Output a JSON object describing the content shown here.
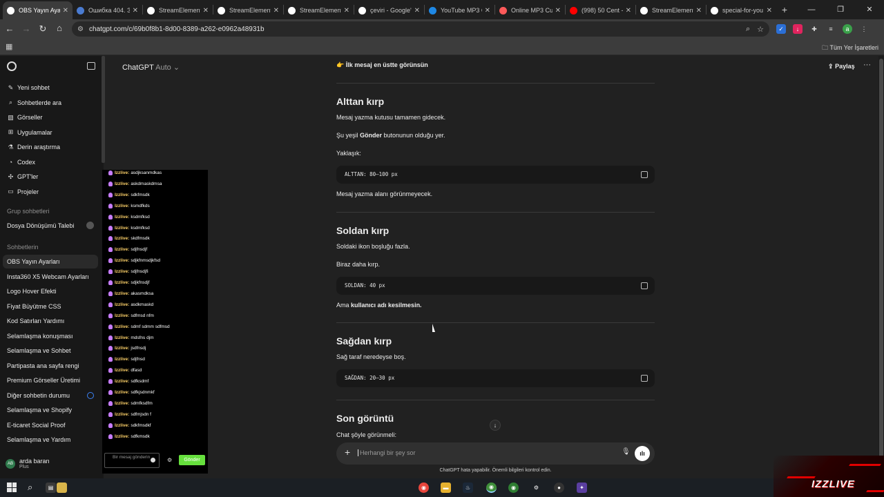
{
  "browser": {
    "tabs": [
      {
        "title": "OBS Yayın Ayarları",
        "active": true,
        "favicon_color": "#ffffff"
      },
      {
        "title": "Ошибка 404. Запр",
        "favicon_color": "#4a7bd1"
      },
      {
        "title": "StreamElements",
        "favicon_color": "#ffffff"
      },
      {
        "title": "StreamElements",
        "favicon_color": "#ffffff"
      },
      {
        "title": "StreamElements",
        "favicon_color": "#ffffff"
      },
      {
        "title": "çeviri - Google'da",
        "favicon_color": "#ffffff"
      },
      {
        "title": "YouTube MP3 Conv",
        "favicon_color": "#1e88e5"
      },
      {
        "title": "Online MP3 Cutter",
        "favicon_color": "#ff5a5a"
      },
      {
        "title": "(998) 50 Cent - M",
        "favicon_color": "#ff0000"
      },
      {
        "title": "StreamElements",
        "favicon_color": "#ffffff"
      },
      {
        "title": "special-for-you",
        "favicon_color": "#ffffff"
      }
    ],
    "url": "chatgpt.com/c/69b0f8b1-8d00-8389-a262-e0962a48931b",
    "bookmarks_all": "Tüm Yer İşaretleri"
  },
  "sidebar": {
    "items": [
      {
        "label": "Yeni sohbet",
        "icon": "compose-icon"
      },
      {
        "label": "Sohbetlerde ara",
        "icon": "search-icon"
      },
      {
        "label": "Görseller",
        "icon": "image-icon"
      },
      {
        "label": "Uygulamalar",
        "icon": "apps-icon"
      },
      {
        "label": "Derin araştırma",
        "icon": "research-icon"
      },
      {
        "label": "Codex",
        "icon": "codex-icon"
      },
      {
        "label": "GPT'ler",
        "icon": "gpts-icon"
      },
      {
        "label": "Projeler",
        "icon": "folder-icon"
      }
    ],
    "group_heading": "Grup sohbetleri",
    "group_items": [
      {
        "label": "Dosya Dönüşümü Talebi"
      }
    ],
    "chats_heading": "Sohbetlerin",
    "chats": [
      "OBS Yayın Ayarları",
      "Insta360 X5 Webcam Ayarları",
      "Logo Hover Efekti",
      "Fiyat Büyütme CSS",
      "Kod Satırları Yardımı",
      "Selamlaşma konuşması",
      "Selamlaşma ve Sohbet",
      "Partipasta ana sayfa rengi",
      "Premium Görseller Üretimi",
      "Diğer sohbetin durumu",
      "Selamlaşma ve Shopify",
      "E-ticaret Social Proof",
      "Selamlaşma ve Yardım"
    ],
    "active_chat": "OBS Yayın Ayarları",
    "user": {
      "initials": "AB",
      "name": "arda baran",
      "plan": "Plus"
    }
  },
  "header": {
    "model": "ChatGPT",
    "model_mode": "Auto",
    "share": "Paylaş"
  },
  "conversation": {
    "top_line_emoji": "👉",
    "top_line": "İlk mesaj en üstte görünsün",
    "s1_title": "Alttan kırp",
    "s1_p1": "Mesaj yazma kutusu tamamen gidecek.",
    "s1_p2_a": "Şu yeşil ",
    "s1_p2_b": "Gönder",
    "s1_p2_c": " butonunun olduğu yer.",
    "s1_p3": "Yaklaşık:",
    "s1_code": "ALTTAN: 80–100 px",
    "s1_p4": "Mesaj yazma alanı görünmeyecek.",
    "s2_title": "Soldan kırp",
    "s2_p1": "Soldaki ikon boşluğu fazla.",
    "s2_p2": "Biraz daha kırp.",
    "s2_code": "SOLDAN: 40 px",
    "s2_p3_a": "Ama ",
    "s2_p3_b": "kullanıcı adı kesilmesin.",
    "s3_title": "Sağdan kırp",
    "s3_p1": "Sağ taraf neredeyse boş.",
    "s3_code": "SAĞDAN: 20–30 px",
    "s4_title": "Son görüntü",
    "s4_p1": "Chat şöyle görünmeli:"
  },
  "composer": {
    "placeholder": "Herhangi bir şey sor",
    "disclaimer": "ChatGPT hata yapabilir. Önemli bilgileri kontrol edin."
  },
  "chat_overlay": {
    "messages": [
      {
        "user": "Izzlive:",
        "text": "asdjksanmdkas"
      },
      {
        "user": "Izzlive:",
        "text": "askdmaskdmsa"
      },
      {
        "user": "Izzlive:",
        "text": "sdkfmsdk"
      },
      {
        "user": "Izzlive:",
        "text": "ksmdfkds"
      },
      {
        "user": "Izzlive:",
        "text": "ksdmfksd"
      },
      {
        "user": "Izzlive:",
        "text": "ksdmfksd"
      },
      {
        "user": "Izzlive:",
        "text": "skdfmsdk"
      },
      {
        "user": "Izzlive:",
        "text": "sdjfnsdjf"
      },
      {
        "user": "Izzlive:",
        "text": "sdjkfnmsdjkfsd"
      },
      {
        "user": "Izzlive:",
        "text": "sdjfnsdjfi"
      },
      {
        "user": "Izzlive:",
        "text": "sdjkfnsdjf"
      },
      {
        "user": "Izzlive:",
        "text": "akasmdksa"
      },
      {
        "user": "Izzlive:",
        "text": "asdkmaskd"
      },
      {
        "user": "Izzlive:",
        "text": "sdfmsd nfm"
      },
      {
        "user": "Izzlive:",
        "text": "sdmf sdmm sdfmsd"
      },
      {
        "user": "Izzlive:",
        "text": "mdsfns djm"
      },
      {
        "user": "Izzlive:",
        "text": "jsdfnsdj"
      },
      {
        "user": "Izzlive:",
        "text": "sdjfnsd"
      },
      {
        "user": "Izzlive:",
        "text": "dfasd"
      },
      {
        "user": "Izzlive:",
        "text": "sdfksdmf"
      },
      {
        "user": "Izzlive:",
        "text": "sdfkjsdnmkf"
      },
      {
        "user": "Izzlive:",
        "text": "sdmfksdfm"
      },
      {
        "user": "Izzlive:",
        "text": "sdfmjsdn f"
      },
      {
        "user": "Izzlive:",
        "text": "sdkfmsdkf"
      },
      {
        "user": "Izzlive:",
        "text": "sdfkmsdk"
      }
    ],
    "input_placeholder": "Bir mesaj gönderin",
    "send_label": "Gönder",
    "send_color": "#66e03d"
  },
  "watermark": {
    "text": "IZZLIVE"
  }
}
